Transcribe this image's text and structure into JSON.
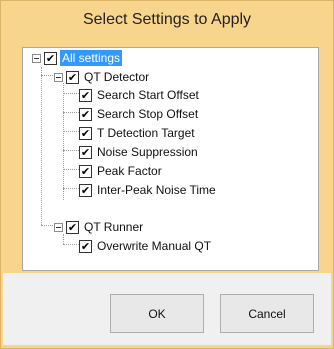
{
  "dialog": {
    "title": "Select Settings to Apply",
    "ok_label": "OK",
    "cancel_label": "Cancel"
  },
  "tree": {
    "root": {
      "label": "All settings",
      "checked": true,
      "selected": true,
      "expanded": true
    },
    "groups": [
      {
        "label": "QT Detector",
        "checked": true,
        "expanded": true,
        "items": [
          {
            "label": "Search Start Offset",
            "checked": true
          },
          {
            "label": "Search Stop Offset",
            "checked": true
          },
          {
            "label": "T Detection Target",
            "checked": true
          },
          {
            "label": "Noise Suppression",
            "checked": true
          },
          {
            "label": "Peak Factor",
            "checked": true
          },
          {
            "label": "Inter-Peak Noise Time",
            "checked": true
          }
        ]
      },
      {
        "label": "QT Runner",
        "checked": true,
        "expanded": true,
        "items": [
          {
            "label": "Overwrite Manual QT",
            "checked": true
          }
        ]
      }
    ]
  },
  "glyphs": {
    "check": "✔"
  }
}
